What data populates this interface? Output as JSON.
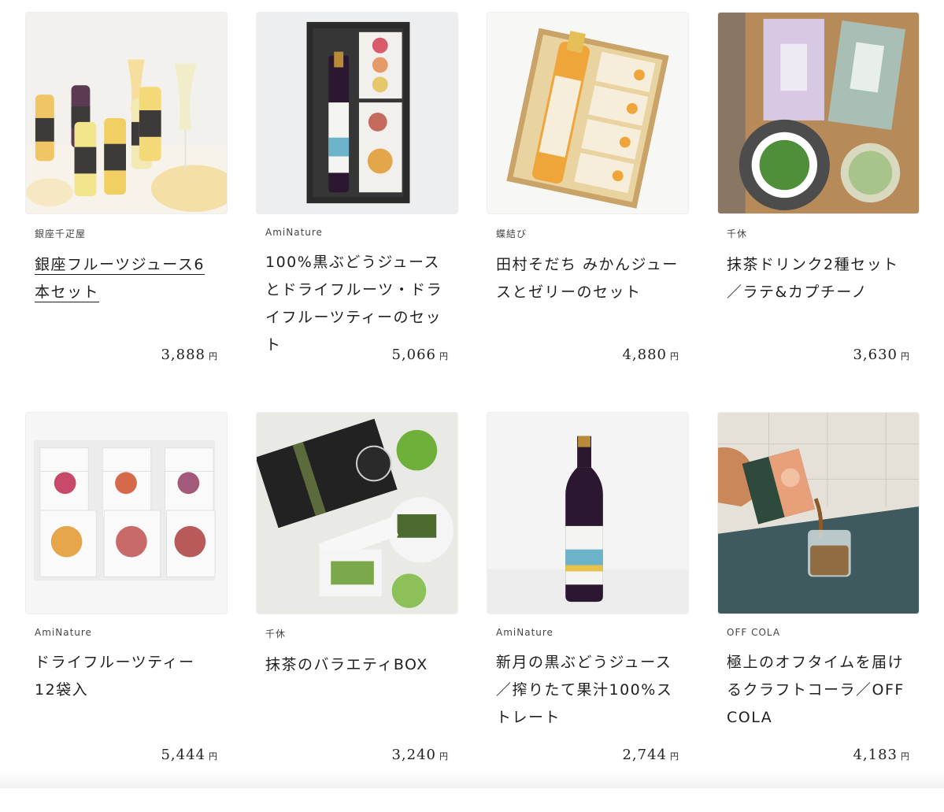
{
  "currency_unit": "円",
  "products": [
    {
      "brand": "銀座千疋屋",
      "title": "銀座フルーツジュース6本セット",
      "price": "3,888",
      "image": "fruit-juice-bottles-photo"
    },
    {
      "brand": "AmiNature",
      "title": "100%黒ぶどうジュースとドライフルーツ・ドライフルーツティーのセット",
      "price": "5,066",
      "image": "grape-juice-gift-box-photo"
    },
    {
      "brand": "蝶結び",
      "title": "田村そだち みかんジュースとゼリーのセット",
      "price": "4,880",
      "image": "mikan-juice-jelly-box-photo"
    },
    {
      "brand": "千休",
      "title": "抹茶ドリンク2種セット／ラテ&カプチーノ",
      "price": "3,630",
      "image": "matcha-drink-set-photo"
    },
    {
      "brand": "AmiNature",
      "title": "ドライフルーツティー 12袋入",
      "price": "5,444",
      "image": "dried-fruit-tea-packs-photo"
    },
    {
      "brand": "千休",
      "title": "抹茶のバラエティBOX",
      "price": "3,240",
      "image": "matcha-variety-box-photo"
    },
    {
      "brand": "AmiNature",
      "title": "新月の黒ぶどうジュース／搾りたて果汁100%ストレート",
      "price": "2,744",
      "image": "grape-juice-bottle-photo"
    },
    {
      "brand": "OFF COLA",
      "title": "極上のオフタイムを届けるクラフトコーラ／OFF COLA",
      "price": "4,183",
      "image": "craft-cola-pour-photo"
    }
  ]
}
